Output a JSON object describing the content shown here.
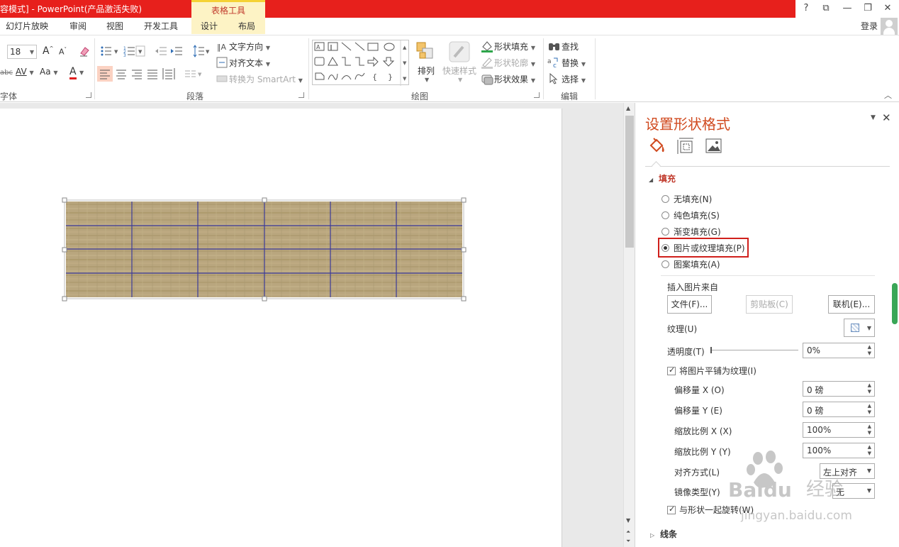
{
  "titlebar": {
    "title": "容模式] -  PowerPoint(产品激活失败)",
    "context_group": "表格工具",
    "help": "?",
    "restore_ribbon": "⧉",
    "minimize": "—",
    "maximize": "❐",
    "close": "✕",
    "colors": {
      "bar": "#e7201c",
      "context": "#fdf3c5"
    }
  },
  "tabs": {
    "items": [
      "幻灯片放映",
      "审阅",
      "视图",
      "开发工具",
      "设计",
      "布局"
    ],
    "login": "登录"
  },
  "ribbon": {
    "font": {
      "size": "18",
      "grow": "A",
      "shrink": "A",
      "strike": "abc",
      "spacing": "AV",
      "case": "Aa",
      "color_letter": "A",
      "label": "字体"
    },
    "paragraph": {
      "text_direction": "文字方向",
      "align_text": "对齐文本",
      "to_smartart": "转换为 SmartArt",
      "label": "段落"
    },
    "drawing": {
      "arrange": "排列",
      "quick_styles": "快速样式",
      "shape_fill": "形状填充",
      "shape_outline": "形状轮廓",
      "shape_effects": "形状效果",
      "label": "绘图"
    },
    "editing": {
      "find": "查找",
      "replace": "替换",
      "select": "选择",
      "label": "编辑"
    }
  },
  "pane": {
    "title": "设置形状格式",
    "icons": [
      "fill-line-icon",
      "size-properties-icon",
      "picture-icon"
    ],
    "fill_section": "填充",
    "options": [
      {
        "label": "无填充(N)",
        "selected": false
      },
      {
        "label": "纯色填充(S)",
        "selected": false
      },
      {
        "label": "渐变填充(G)",
        "selected": false
      },
      {
        "label": "图片或纹理填充(P)",
        "selected": true
      },
      {
        "label": "图案填充(A)",
        "selected": false
      }
    ],
    "insert_from": "插入图片来自",
    "file_button": "文件(F)...",
    "clipboard_button": "剪贴板(C)",
    "online_button": "联机(E)...",
    "texture_label": "纹理(U)",
    "transparency_label": "透明度(T)",
    "transparency_value": "0%",
    "tile_checkbox": "将图片平铺为纹理(I)",
    "offset_x_label": "偏移量 X (O)",
    "offset_x_value": "0 磅",
    "offset_y_label": "偏移量 Y (E)",
    "offset_y_value": "0 磅",
    "scale_x_label": "缩放比例 X (X)",
    "scale_x_value": "100%",
    "scale_y_label": "缩放比例 Y (Y)",
    "scale_y_value": "100%",
    "align_label": "对齐方式(L)",
    "align_value": "左上对齐",
    "mirror_label": "镜像类型(Y)",
    "mirror_value": "无",
    "rotate_checkbox": "与形状一起旋转(W)",
    "line_section": "线条",
    "colors": {
      "title": "#d04a1f",
      "highlight": "#d0201c"
    }
  },
  "watermark": {
    "brand": "Baidu",
    "brand_cn": "经验",
    "url": "jingyan.baidu.com"
  }
}
